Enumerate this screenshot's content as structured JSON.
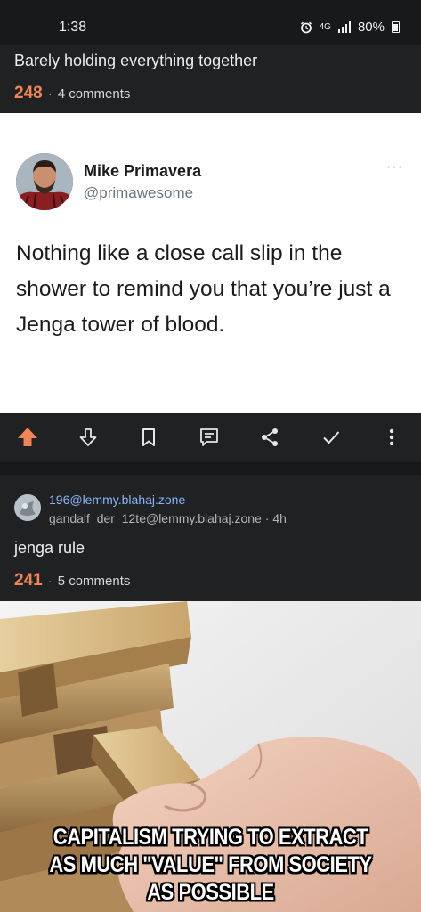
{
  "status": {
    "time": "1:38",
    "network": "4G",
    "battery": "80%"
  },
  "post1": {
    "title": "Barely holding everything together",
    "score": "248",
    "separator": "·",
    "comments": "4 comments"
  },
  "tweet": {
    "name": "Mike Primavera",
    "handle": "@primawesome",
    "more": "···",
    "text": "Nothing like a close call slip in the shower to remind you that you’re just a Jenga tower of blood."
  },
  "actions": [
    "upvote-icon",
    "downvote-icon",
    "bookmark-icon",
    "comment-icon",
    "share-icon",
    "check-icon",
    "more-icon"
  ],
  "post2": {
    "community": "196@lemmy.blahaj.zone",
    "meta": "gandalf_der_12te@lemmy.blahaj.zone · 4h",
    "title": "jenga rule",
    "score": "241",
    "separator": "·",
    "comments": "5 comments"
  },
  "meme": {
    "caption_line1": "CAPITALISM TRYING TO EXTRACT",
    "caption_line2": "AS MUCH \"VALUE\" FROM SOCIETY",
    "caption_line3": "AS POSSIBLE"
  },
  "colors": {
    "accent_score": "#f08556",
    "upvote": "#f08556",
    "background": "#1f2123",
    "link": "#8ab4f8"
  }
}
